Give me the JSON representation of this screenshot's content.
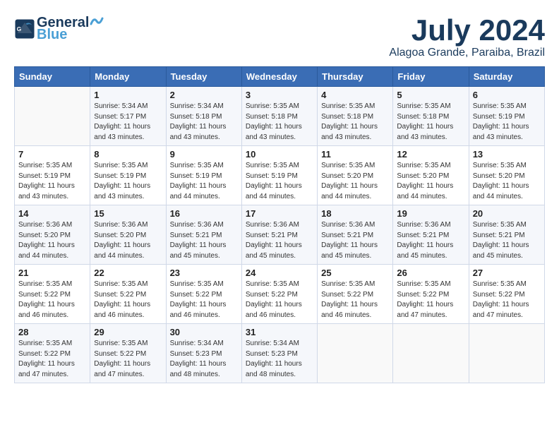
{
  "header": {
    "logo_text_general": "General",
    "logo_text_blue": "Blue",
    "month_title": "July 2024",
    "location": "Alagoa Grande, Paraiba, Brazil"
  },
  "calendar": {
    "days_of_week": [
      "Sunday",
      "Monday",
      "Tuesday",
      "Wednesday",
      "Thursday",
      "Friday",
      "Saturday"
    ],
    "weeks": [
      [
        {
          "day": "",
          "info": ""
        },
        {
          "day": "1",
          "info": "Sunrise: 5:34 AM\nSunset: 5:17 PM\nDaylight: 11 hours\nand 43 minutes."
        },
        {
          "day": "2",
          "info": "Sunrise: 5:34 AM\nSunset: 5:18 PM\nDaylight: 11 hours\nand 43 minutes."
        },
        {
          "day": "3",
          "info": "Sunrise: 5:35 AM\nSunset: 5:18 PM\nDaylight: 11 hours\nand 43 minutes."
        },
        {
          "day": "4",
          "info": "Sunrise: 5:35 AM\nSunset: 5:18 PM\nDaylight: 11 hours\nand 43 minutes."
        },
        {
          "day": "5",
          "info": "Sunrise: 5:35 AM\nSunset: 5:18 PM\nDaylight: 11 hours\nand 43 minutes."
        },
        {
          "day": "6",
          "info": "Sunrise: 5:35 AM\nSunset: 5:19 PM\nDaylight: 11 hours\nand 43 minutes."
        }
      ],
      [
        {
          "day": "7",
          "info": "Sunrise: 5:35 AM\nSunset: 5:19 PM\nDaylight: 11 hours\nand 43 minutes."
        },
        {
          "day": "8",
          "info": "Sunrise: 5:35 AM\nSunset: 5:19 PM\nDaylight: 11 hours\nand 43 minutes."
        },
        {
          "day": "9",
          "info": "Sunrise: 5:35 AM\nSunset: 5:19 PM\nDaylight: 11 hours\nand 44 minutes."
        },
        {
          "day": "10",
          "info": "Sunrise: 5:35 AM\nSunset: 5:19 PM\nDaylight: 11 hours\nand 44 minutes."
        },
        {
          "day": "11",
          "info": "Sunrise: 5:35 AM\nSunset: 5:20 PM\nDaylight: 11 hours\nand 44 minutes."
        },
        {
          "day": "12",
          "info": "Sunrise: 5:35 AM\nSunset: 5:20 PM\nDaylight: 11 hours\nand 44 minutes."
        },
        {
          "day": "13",
          "info": "Sunrise: 5:35 AM\nSunset: 5:20 PM\nDaylight: 11 hours\nand 44 minutes."
        }
      ],
      [
        {
          "day": "14",
          "info": "Sunrise: 5:36 AM\nSunset: 5:20 PM\nDaylight: 11 hours\nand 44 minutes."
        },
        {
          "day": "15",
          "info": "Sunrise: 5:36 AM\nSunset: 5:20 PM\nDaylight: 11 hours\nand 44 minutes."
        },
        {
          "day": "16",
          "info": "Sunrise: 5:36 AM\nSunset: 5:21 PM\nDaylight: 11 hours\nand 45 minutes."
        },
        {
          "day": "17",
          "info": "Sunrise: 5:36 AM\nSunset: 5:21 PM\nDaylight: 11 hours\nand 45 minutes."
        },
        {
          "day": "18",
          "info": "Sunrise: 5:36 AM\nSunset: 5:21 PM\nDaylight: 11 hours\nand 45 minutes."
        },
        {
          "day": "19",
          "info": "Sunrise: 5:36 AM\nSunset: 5:21 PM\nDaylight: 11 hours\nand 45 minutes."
        },
        {
          "day": "20",
          "info": "Sunrise: 5:35 AM\nSunset: 5:21 PM\nDaylight: 11 hours\nand 45 minutes."
        }
      ],
      [
        {
          "day": "21",
          "info": "Sunrise: 5:35 AM\nSunset: 5:22 PM\nDaylight: 11 hours\nand 46 minutes."
        },
        {
          "day": "22",
          "info": "Sunrise: 5:35 AM\nSunset: 5:22 PM\nDaylight: 11 hours\nand 46 minutes."
        },
        {
          "day": "23",
          "info": "Sunrise: 5:35 AM\nSunset: 5:22 PM\nDaylight: 11 hours\nand 46 minutes."
        },
        {
          "day": "24",
          "info": "Sunrise: 5:35 AM\nSunset: 5:22 PM\nDaylight: 11 hours\nand 46 minutes."
        },
        {
          "day": "25",
          "info": "Sunrise: 5:35 AM\nSunset: 5:22 PM\nDaylight: 11 hours\nand 46 minutes."
        },
        {
          "day": "26",
          "info": "Sunrise: 5:35 AM\nSunset: 5:22 PM\nDaylight: 11 hours\nand 47 minutes."
        },
        {
          "day": "27",
          "info": "Sunrise: 5:35 AM\nSunset: 5:22 PM\nDaylight: 11 hours\nand 47 minutes."
        }
      ],
      [
        {
          "day": "28",
          "info": "Sunrise: 5:35 AM\nSunset: 5:22 PM\nDaylight: 11 hours\nand 47 minutes."
        },
        {
          "day": "29",
          "info": "Sunrise: 5:35 AM\nSunset: 5:22 PM\nDaylight: 11 hours\nand 47 minutes."
        },
        {
          "day": "30",
          "info": "Sunrise: 5:34 AM\nSunset: 5:23 PM\nDaylight: 11 hours\nand 48 minutes."
        },
        {
          "day": "31",
          "info": "Sunrise: 5:34 AM\nSunset: 5:23 PM\nDaylight: 11 hours\nand 48 minutes."
        },
        {
          "day": "",
          "info": ""
        },
        {
          "day": "",
          "info": ""
        },
        {
          "day": "",
          "info": ""
        }
      ]
    ]
  }
}
